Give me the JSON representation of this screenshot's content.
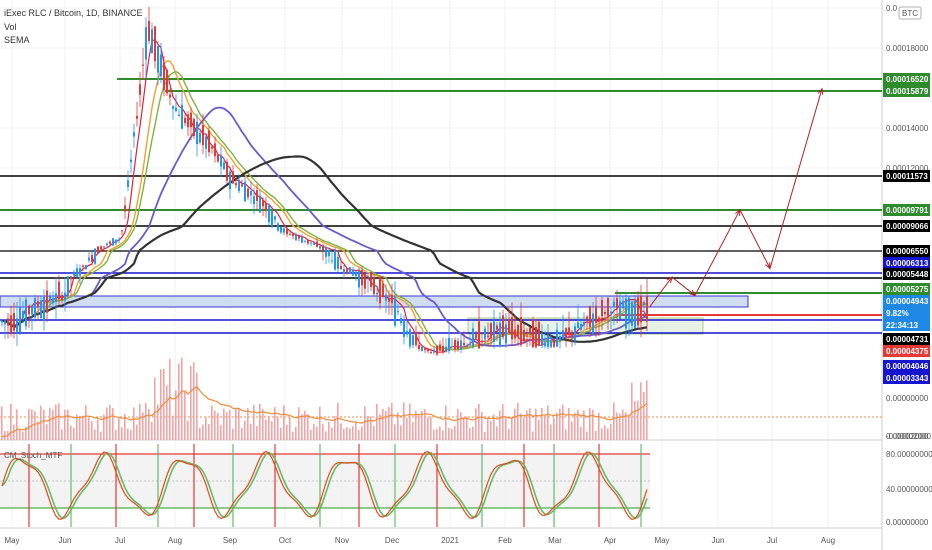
{
  "header": {
    "symbol": "iExec RLC / Bitcoin, 1D, BINANCE",
    "indicator_vol": "Vol",
    "indicator_sema": "SEMA",
    "currency_badge": "BTC"
  },
  "price_axis": {
    "ticks": [
      "0.0",
      "0.00018000",
      "0.00014000",
      "0.00012000",
      "0.00002000"
    ],
    "tick_values": [
      0.0002,
      0.00018,
      0.00014,
      0.00012,
      2e-05
    ]
  },
  "volume_axis": {
    "ticks": [
      "0.00000000",
      "-0.00002000"
    ]
  },
  "stoch_panel": {
    "title": "CM_Stoch_MTF",
    "ticks": [
      "80.00000000",
      "40.00000000",
      "0.00000000"
    ],
    "upper_band": 80,
    "lower_band": 20
  },
  "time_axis": {
    "labels": [
      "May",
      "Jun",
      "Jul",
      "Aug",
      "Sep",
      "Oct",
      "Nov",
      "Dec",
      "2021",
      "Feb",
      "Mar",
      "Apr",
      "May",
      "Jun",
      "Jul",
      "Aug"
    ]
  },
  "level_badges": [
    {
      "label": "0.00016520",
      "color": "#2e8b2e",
      "text_color": "#ffffff"
    },
    {
      "label": "0.00015879",
      "color": "#2e8b2e",
      "text_color": "#ffffff"
    },
    {
      "label": "0.00011573",
      "color": "#000000",
      "text_color": "#ffffff"
    },
    {
      "label": "0.00009791",
      "color": "#2e8b2e",
      "text_color": "#ffffff"
    },
    {
      "label": "0.00009066",
      "color": "#000000",
      "text_color": "#ffffff"
    },
    {
      "label": "0.00006550",
      "color": "#000000",
      "text_color": "#ffffff"
    },
    {
      "label": "0.00006313",
      "color": "#1515d0",
      "text_color": "#ffffff"
    },
    {
      "label": "0.00005448",
      "color": "#000000",
      "text_color": "#ffffff"
    },
    {
      "label": "0.00005275",
      "color": "#2e8b2e",
      "text_color": "#ffffff"
    },
    {
      "label": "0.00004943",
      "color": "#1e88e5",
      "text_color": "#ffffff"
    },
    {
      "label": "9.82%",
      "color": "#1e88e5",
      "text_color": "#ffffff"
    },
    {
      "label": "22:34:13",
      "color": "#1e88e5",
      "text_color": "#ffffff"
    },
    {
      "label": "0.00004731",
      "color": "#000000",
      "text_color": "#ffffff"
    },
    {
      "label": "0.00004375",
      "color": "#e53935",
      "text_color": "#ffffff"
    },
    {
      "label": "0.00004046",
      "color": "#1515d0",
      "text_color": "#ffffff"
    },
    {
      "label": "0.00003343",
      "color": "#1515d0",
      "text_color": "#ffffff"
    }
  ],
  "colors": {
    "up_candle": "#2196f3",
    "down_candle": "#e53935",
    "green_level": "#2e8b2e",
    "black_level": "#000000",
    "blue_level": "#1515d0",
    "sma_long": "#333333",
    "sma_mid": "#6a5acd",
    "ema_fast": "#e0203c",
    "ema_orange": "#f0a030",
    "ema_green": "#7cb342",
    "projection": "#b22222",
    "volume": "#f3a3a3",
    "volume_ma": "#f08c3c",
    "stoch_k": "#e64a19",
    "stoch_d": "#66bb6a"
  },
  "chart_data": {
    "type": "candlestick",
    "title": "iExec RLC / Bitcoin, 1D, BINANCE",
    "price_levels_green": [
      0.0001652,
      0.00015879,
      9.791e-05,
      5.275e-05
    ],
    "price_levels_black": [
      0.00011573,
      9.066e-05,
      6.55e-05,
      5.448e-05,
      4.731e-05
    ],
    "price_levels_blue": [
      6.313e-05,
      4.046e-05,
      3.343e-05
    ],
    "last_price": 4.943e-05,
    "change_pct": "9.82%",
    "countdown": "22:34:13",
    "red_level": 4.375e-05,
    "approx_close_path": [
      {
        "x": "May",
        "y": 4.7e-05
      },
      {
        "x": "Jun",
        "y": 5.2e-05
      },
      {
        "x": "Jul",
        "y": 7.8e-05
      },
      {
        "x": "Jul-15",
        "y": 0.00019
      },
      {
        "x": "Aug",
        "y": 0.00015
      },
      {
        "x": "Aug-20",
        "y": 0.00013
      },
      {
        "x": "Sep",
        "y": 0.000115
      },
      {
        "x": "Sep-20",
        "y": 0.0001
      },
      {
        "x": "Oct",
        "y": 8.5e-05
      },
      {
        "x": "Nov",
        "y": 6e-05
      },
      {
        "x": "Dec",
        "y": 5e-05
      },
      {
        "x": "Dec-20",
        "y": 4e-05
      },
      {
        "x": "2021",
        "y": 4.3e-05
      },
      {
        "x": "Feb",
        "y": 4.6e-05
      },
      {
        "x": "Mar",
        "y": 4.4e-05
      },
      {
        "x": "Apr",
        "y": 4.9e-05
      }
    ],
    "projection_path": [
      {
        "x": "Apr-20",
        "y": 4.9e-05
      },
      {
        "x": "May",
        "y": 5.5e-05
      },
      {
        "x": "May-10",
        "y": 5.2e-05
      },
      {
        "x": "Jun-05",
        "y": 9.8e-05
      },
      {
        "x": "Jun-25",
        "y": 6e-05
      },
      {
        "x": "Aug",
        "y": 0.00016
      }
    ]
  }
}
